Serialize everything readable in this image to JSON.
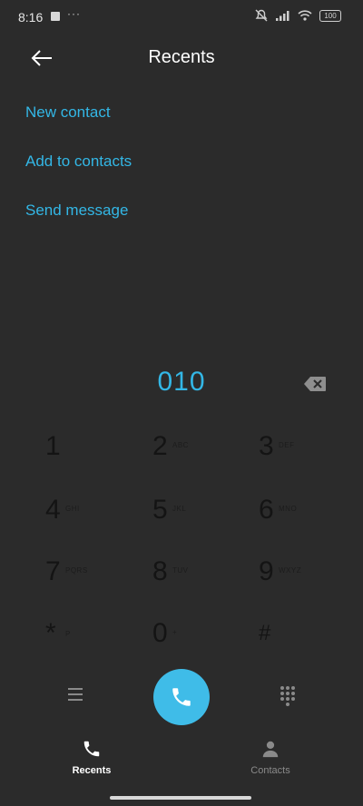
{
  "status_bar": {
    "time": "8:16",
    "dots": "···",
    "battery": "100"
  },
  "header": {
    "title": "Recents"
  },
  "actions": [
    {
      "label": "New contact"
    },
    {
      "label": "Add to contacts"
    },
    {
      "label": "Send message"
    }
  ],
  "dialer": {
    "number": "010",
    "keys": [
      {
        "digit": "1",
        "sub": ""
      },
      {
        "digit": "2",
        "sub": "ABC"
      },
      {
        "digit": "3",
        "sub": "DEF"
      },
      {
        "digit": "4",
        "sub": "GHI"
      },
      {
        "digit": "5",
        "sub": "JKL"
      },
      {
        "digit": "6",
        "sub": "MNO"
      },
      {
        "digit": "7",
        "sub": "PQRS"
      },
      {
        "digit": "8",
        "sub": "TUV"
      },
      {
        "digit": "9",
        "sub": "WXYZ"
      },
      {
        "digit": "*",
        "sub": "P"
      },
      {
        "digit": "0",
        "sub": "+"
      },
      {
        "digit": "#",
        "sub": ""
      }
    ]
  },
  "bottom_nav": {
    "recents": "Recents",
    "contacts": "Contacts"
  },
  "colors": {
    "background": "#2b2b2b",
    "accent": "#33b7e6",
    "call_button": "#3fbce8"
  },
  "icons": {
    "back": "arrow-left-icon",
    "backspace": "backspace-icon",
    "menu": "menu-icon",
    "call": "phone-icon",
    "keypad": "dialpad-icon",
    "recents": "phone-icon",
    "contacts": "person-icon"
  }
}
